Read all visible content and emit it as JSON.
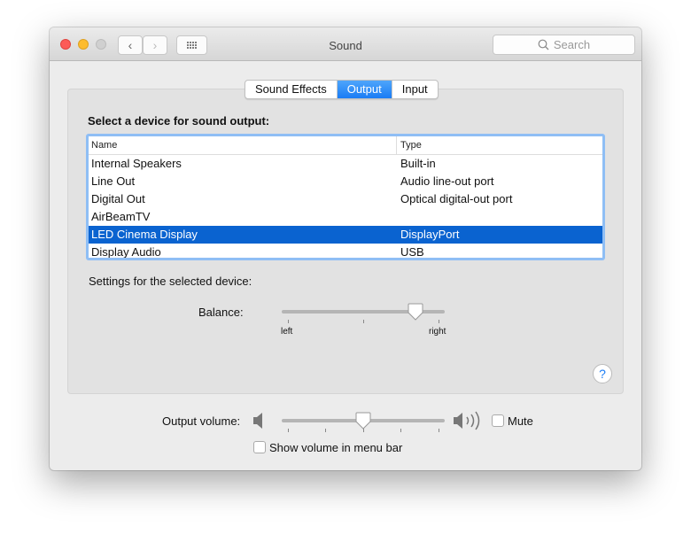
{
  "window": {
    "title": "Sound"
  },
  "toolbar": {
    "search_placeholder": "Search"
  },
  "tabs": [
    {
      "label": "Sound Effects",
      "active": false
    },
    {
      "label": "Output",
      "active": true
    },
    {
      "label": "Input",
      "active": false
    }
  ],
  "output": {
    "heading": "Select a device for sound output:",
    "columns": [
      "Name",
      "Type"
    ],
    "devices": [
      {
        "name": "Internal Speakers",
        "type": "Built-in"
      },
      {
        "name": "Line Out",
        "type": "Audio line-out port"
      },
      {
        "name": "Digital Out",
        "type": "Optical digital-out port"
      },
      {
        "name": "AirBeamTV",
        "type": ""
      },
      {
        "name": "LED Cinema Display",
        "type": "DisplayPort",
        "selected": true
      },
      {
        "name": "Display Audio",
        "type": "USB"
      }
    ],
    "settings_label": "Settings for the selected device:",
    "balance": {
      "label": "Balance:",
      "left": "left",
      "right": "right",
      "value": 0.82
    }
  },
  "volume": {
    "label": "Output volume:",
    "value": 0.5,
    "mute_label": "Mute",
    "mute_checked": false,
    "show_in_menu_label": "Show volume in menu bar",
    "show_in_menu_checked": false
  },
  "colors": {
    "accent": "#1a7cf5",
    "selection": "#0a63d0"
  }
}
